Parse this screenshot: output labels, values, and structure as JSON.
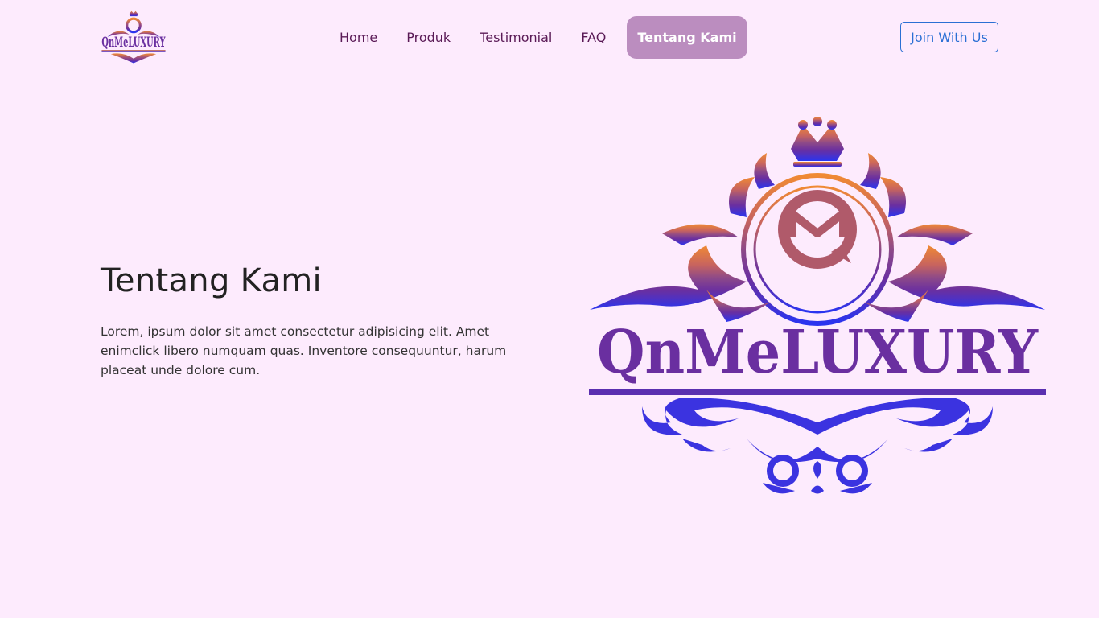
{
  "brand": {
    "name": "QnMeLUXURY",
    "colors": {
      "orange": "#f08a34",
      "purple": "#6a2fa0",
      "blue": "#2a34f0"
    }
  },
  "nav": {
    "items": [
      {
        "label": "Home"
      },
      {
        "label": "Produk"
      },
      {
        "label": "Testimonial"
      },
      {
        "label": "FAQ"
      },
      {
        "label": "Tentang Kami",
        "active": true
      }
    ],
    "join_label": "Join With Us"
  },
  "hero": {
    "title": "Tentang Kami",
    "text": "Lorem, ipsum dolor sit amet consectetur adipisicing elit. Amet enimclick libero numquam quas. Inventore consequuntur, harum placeat unde dolore cum."
  },
  "colors": {
    "background": "#fdebfd",
    "nav_text": "#5a1a56",
    "active_bg": "#bb8dbf",
    "join_border": "#2a6fd4"
  }
}
